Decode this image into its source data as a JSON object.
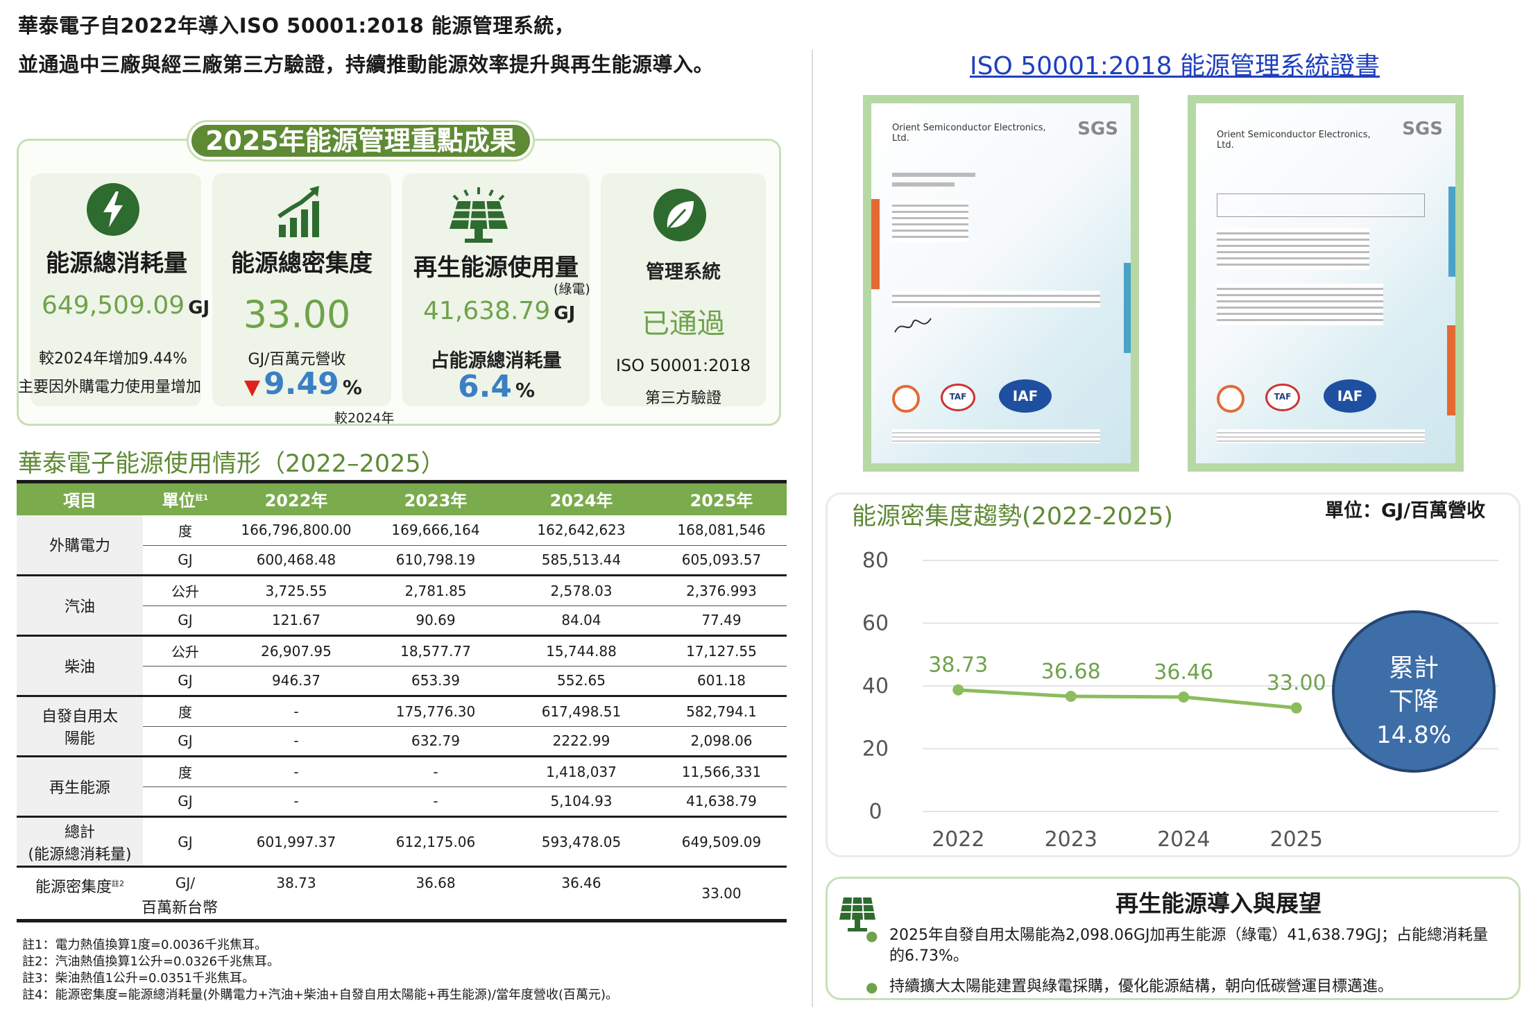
{
  "intro": {
    "line1": "華泰電子自2022年導入ISO 50001:2018 能源管理系統，",
    "line2": "並通過中三廠與經三廠第三方驗證，持續推動能源效率提升與再生能源導入。"
  },
  "highlights": {
    "banner": "2025年能源管理重點成果",
    "cards": [
      {
        "icon": "lightning-bolt",
        "title": "能源總消耗量",
        "value": "649,509.09",
        "unit": "GJ",
        "line1": "較2024年增加9.44%",
        "line2": "主要因外購電力使用量增加"
      },
      {
        "icon": "bar-chart-growth",
        "title": "能源總密集度",
        "value": "33.00",
        "sub": "GJ/百萬元營收",
        "arrow": "▼",
        "change": "9.49",
        "pct": "%",
        "note": "較2024年"
      },
      {
        "icon": "solar-panel",
        "title": "再生能源使用量",
        "paren": "(綠電)",
        "value": "41,638.79",
        "unit": "GJ",
        "sub": "占能源總消耗量",
        "share": "6.4",
        "pct": "%"
      },
      {
        "icon": "leaf",
        "title": "管理系統",
        "status": "已通過",
        "std": "ISO 50001:2018",
        "verify": "第三方驗證"
      }
    ]
  },
  "usage_table": {
    "title": "華泰電子能源使用情形（2022–2025）",
    "headers": {
      "item": "項目",
      "unit": "單位",
      "unit_note": "註1",
      "years": [
        "2022年",
        "2023年",
        "2024年",
        "2025年"
      ]
    },
    "rows": [
      {
        "item": "外購電力",
        "unit": "度",
        "vals": [
          "166,796,800.00",
          "169,666,164",
          "162,642,623",
          "168,081,546"
        ]
      },
      {
        "unit": "GJ",
        "vals": [
          "600,468.48",
          "610,798.19",
          "585,513.44",
          "605,093.57"
        ]
      },
      {
        "item": "汽油",
        "unit": "公升",
        "vals": [
          "3,725.55",
          "2,781.85",
          "2,578.03",
          "2,376.993"
        ]
      },
      {
        "unit": "GJ",
        "vals": [
          "121.67",
          "90.69",
          "84.04",
          "77.49"
        ]
      },
      {
        "item": "柴油",
        "unit": "公升",
        "vals": [
          "26,907.95",
          "18,577.77",
          "15,744.88",
          "17,127.55"
        ]
      },
      {
        "unit": "GJ",
        "vals": [
          "946.37",
          "653.39",
          "552.65",
          "601.18"
        ]
      },
      {
        "item": "自發自用太陽能",
        "unit": "度",
        "vals": [
          "-",
          "175,776.30",
          "617,498.51",
          "582,794.1"
        ]
      },
      {
        "unit": "GJ",
        "vals": [
          "-",
          "632.79",
          "2222.99",
          "2,098.06"
        ]
      },
      {
        "item": "再生能源",
        "unit": "度",
        "vals": [
          "-",
          "-",
          "1,418,037",
          "11,566,331"
        ]
      },
      {
        "unit": "GJ",
        "vals": [
          "-",
          "-",
          "5,104.93",
          "41,638.79"
        ]
      }
    ],
    "total": {
      "item1": "總計",
      "item2": "(能源總消耗量)",
      "unit": "GJ",
      "vals": [
        "601,997.37",
        "612,175.06",
        "593,478.05",
        "649,509.09"
      ]
    },
    "intensity": {
      "item": "能源密集度",
      "note": "註2",
      "unit1": "GJ/",
      "unit2": "百萬新台幣",
      "vals": [
        "38.73",
        "36.68",
        "36.46",
        "33.00"
      ]
    },
    "notes": [
      "註1：電力熱值換算1度=0.0036千兆焦耳。",
      "註2：汽油熱值換算1公升=0.0326千兆焦耳。",
      "註3：柴油熱值1公升=0.0351千兆焦耳。",
      "註4：能源密集度=能源總消耗量(外購電力+汽油+柴油+自發自用太陽能+再生能源)/當年度營收(百萬元)。"
    ]
  },
  "certificates": {
    "link": "ISO 50001:2018 能源管理系統證書",
    "company": "Orient Semiconductor Electronics, Ltd.",
    "brand": "SGS",
    "badges": [
      "TAF",
      "IAF"
    ]
  },
  "chart_data": {
    "type": "line",
    "title": "能源密集度趨勢(2022-2025)",
    "unit": "單位：GJ/百萬營收",
    "categories": [
      "2022",
      "2023",
      "2024",
      "2025"
    ],
    "values": [
      38.73,
      36.68,
      36.46,
      33.0
    ],
    "labels": [
      "38.73",
      "36.68",
      "36.46",
      "33.00"
    ],
    "ylim": [
      0,
      80
    ],
    "yticks": [
      "0",
      "20",
      "40",
      "60",
      "80"
    ],
    "grid": true,
    "color": "#8cbc5d",
    "callout": {
      "l1": "累計",
      "l2": "下降",
      "l3": "14.8%"
    }
  },
  "renewable": {
    "title": "再生能源導入與展望",
    "bullets": [
      "2025年自發自用太陽能為2,098.06GJ加再生能源（綠電）41,638.79GJ；占能總消耗量的6.73%。",
      "持續擴大太陽能建置與綠電採購，優化能源結構，朝向低碳營運目標邁進。"
    ]
  },
  "colors": {
    "green": "#6fa24c",
    "dark_green": "#2e6b2f",
    "blue": "#3b7fc4",
    "red": "#e02020",
    "header_green": "#7aab4d"
  }
}
